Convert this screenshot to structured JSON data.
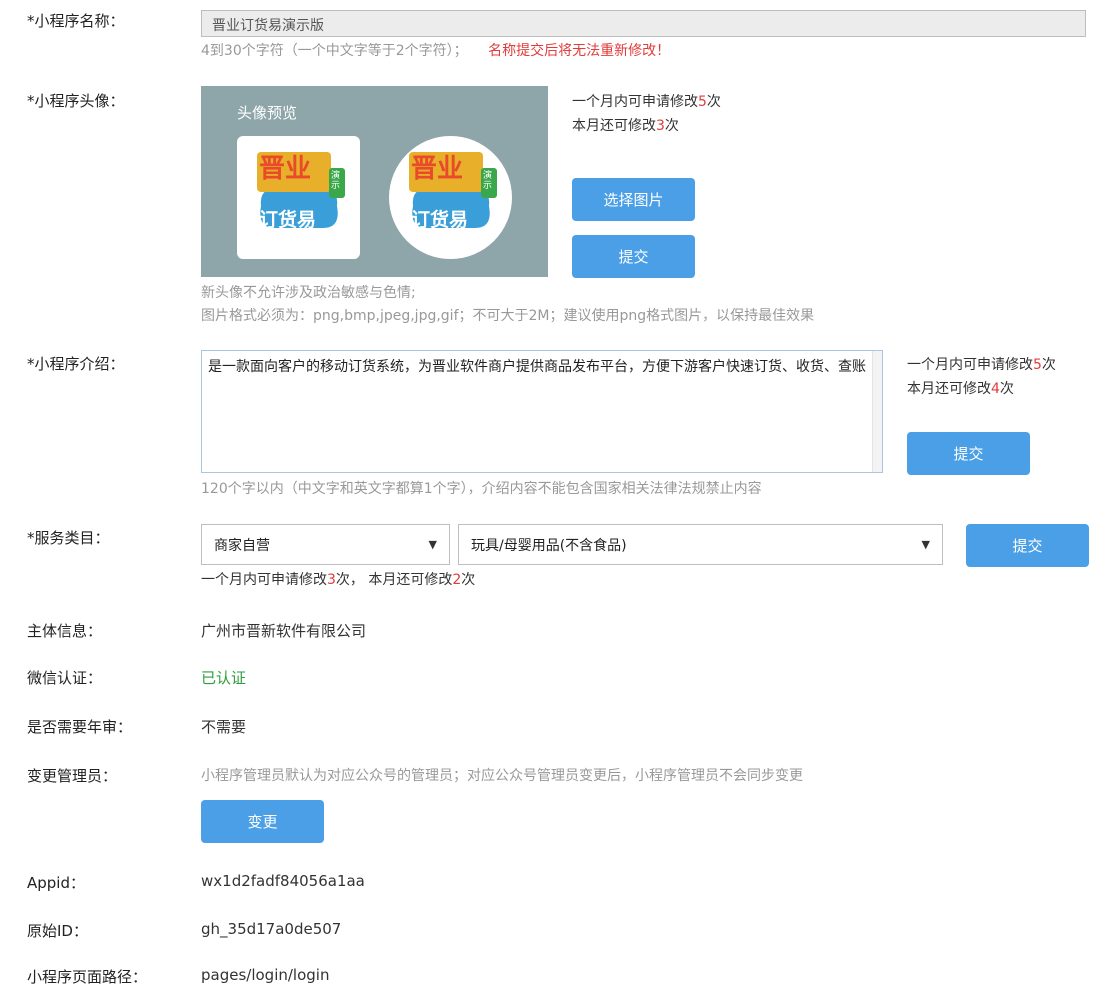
{
  "name_field": {
    "label": "*小程序名称：",
    "value": "晋业订货易演示版",
    "hint": "4到30个字符（一个中文字等于2个字符）；",
    "warning": "名称提交后将无法重新修改！"
  },
  "avatar": {
    "label": "*小程序头像：",
    "preview_title": "头像预览",
    "logo_text_top": "晋业",
    "logo_text_bottom": "订货易",
    "logo_badge": "演示",
    "limit_prefix": "一个月内可申请修改",
    "limit_count": "5",
    "limit_suffix": "次",
    "remain_prefix": "本月还可修改",
    "remain_count": "3",
    "remain_suffix": "次",
    "choose_button": "选择图片",
    "submit_button": "提交",
    "note1": "新头像不允许涉及政治敏感与色情;",
    "note2": "图片格式必须为：png,bmp,jpeg,jpg,gif；不可大于2M；建议使用png格式图片，以保持最佳效果"
  },
  "intro": {
    "label": "*小程序介绍：",
    "text": " 是一款面向客户的移动订货系统，为晋业软件商户提供商品发布平台，方便下游客户快速订货、收货、查账",
    "limit_prefix": "一个月内可申请修改",
    "limit_count": "5",
    "limit_suffix": "次",
    "remain_prefix": "本月还可修改",
    "remain_count": "4",
    "remain_suffix": "次",
    "submit_button": "提交",
    "hint": "120个字以内（中文字和英文字都算1个字），介绍内容不能包含国家相关法律法规禁止内容"
  },
  "category": {
    "label": "*服务类目：",
    "select1": "商家自营",
    "select2": "玩具/母婴用品(不含食品)",
    "submit_button": "提交",
    "limit_prefix": "一个月内可申请修改",
    "limit_count": "3",
    "limit_mid": "次， 本月还可修改",
    "remain_count": "2",
    "remain_suffix": "次"
  },
  "subject": {
    "label": "主体信息：",
    "value": "广州市晋新软件有限公司"
  },
  "wechat_verify": {
    "label": "微信认证：",
    "value": "已认证"
  },
  "annual_review": {
    "label": "是否需要年审：",
    "value": "不需要"
  },
  "admin": {
    "label": "变更管理员：",
    "note": "小程序管理员默认为对应公众号的管理员；对应公众号管理员变更后，小程序管理员不会同步变更",
    "change_button": "变更"
  },
  "appid": {
    "label": "Appid：",
    "value": "wx1d2fadf84056a1aa"
  },
  "original_id": {
    "label": "原始ID：",
    "value": "gh_35d17a0de507"
  },
  "page_path": {
    "label": "小程序页面路径：",
    "value": "pages/login/login"
  },
  "colors": {
    "accent": "#4a9fe6",
    "warning": "#e23b3b",
    "verified": "#2e9e3e"
  }
}
